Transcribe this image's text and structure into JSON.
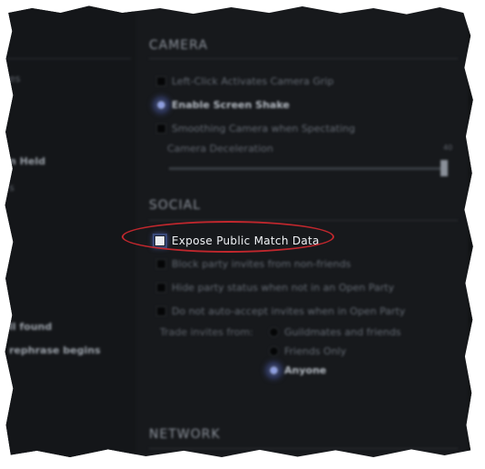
{
  "left_panel": {
    "items": [
      {
        "label": "es",
        "dim": true
      },
      {
        "label": "n Held",
        "dim": false
      },
      {
        "label": "s",
        "dim": true
      },
      {
        "label": "ll found",
        "dim": false
      },
      {
        "label": "rephrase begins",
        "dim": false
      }
    ]
  },
  "camera": {
    "title": "CAMERA",
    "options": [
      {
        "label": "Left-Click Activates Camera Grip",
        "kind": "checkbox",
        "checked": false
      },
      {
        "label": "Enable Screen Shake",
        "kind": "radio",
        "checked": true
      },
      {
        "label": "Smoothing Camera when Spectating",
        "kind": "checkbox",
        "checked": false
      }
    ],
    "slider": {
      "label": "Camera Deceleration",
      "value": "40",
      "fraction": 0.98
    }
  },
  "social": {
    "title": "SOCIAL",
    "highlighted_option": {
      "label": "Expose Public Match Data",
      "checked": false
    },
    "options": [
      {
        "label": "Block party invites from non-friends",
        "checked": false
      },
      {
        "label": "Hide party status when not in an Open Party",
        "checked": false
      },
      {
        "label": "Do not auto-accept invites when in Open Party",
        "checked": false
      }
    ],
    "trade_label": "Trade invites from:",
    "trade_options": [
      {
        "label": "Guildmates and friends",
        "checked": false
      },
      {
        "label": "Friends Only",
        "checked": false
      },
      {
        "label": "Anyone",
        "checked": true
      }
    ]
  },
  "network": {
    "title": "NETWORK"
  },
  "colors": {
    "panel_bg": "#17191c",
    "annotation": "#c0272d",
    "radio_active": "#8f9fe0"
  }
}
